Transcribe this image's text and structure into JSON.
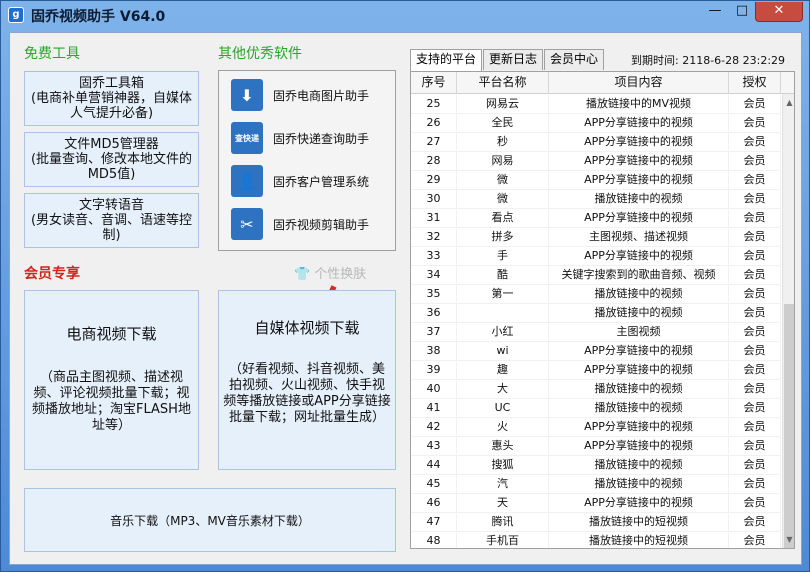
{
  "window": {
    "title": "固乔视频助手 V64.0",
    "app_icon": "g",
    "minimize": "—",
    "maximize": "□",
    "close": "✕"
  },
  "free_tools": {
    "heading": "免费工具",
    "buttons": [
      {
        "title": "固乔工具箱",
        "desc": "(电商补单营销神器，自媒体人气提升必备)"
      },
      {
        "title": "文件MD5管理器",
        "desc": "(批量查询、修改本地文件的MD5值)"
      },
      {
        "title": "文字转语音",
        "desc": "(男女读音、音调、语速等控制)"
      }
    ]
  },
  "other_software": {
    "heading": "其他优秀软件",
    "items": [
      {
        "label": "固乔电商图片助手",
        "icon": "download-icon",
        "glyph": "⬇"
      },
      {
        "label": "固乔快递查询助手",
        "icon": "express-query-icon",
        "glyph": "查快递"
      },
      {
        "label": "固乔客户管理系统",
        "icon": "customer-icon",
        "glyph": "👤"
      },
      {
        "label": "固乔视频剪辑助手",
        "icon": "scissors-icon",
        "glyph": "✂"
      }
    ]
  },
  "skin": {
    "label": "个性换肤",
    "icon": "tshirt-icon",
    "glyph": "👕"
  },
  "arrow_glyph": "⬇",
  "member": {
    "heading": "会员专享",
    "ecom_video": {
      "title": "电商视频下载",
      "desc": "（商品主图视频、描述视频、评论视频批量下载；视频播放地址；淘宝FLASH地址等）"
    },
    "media_video": {
      "title": "自媒体视频下载",
      "desc": "（好看视频、抖音视频、美拍视频、火山视频、快手视频等播放链接或APP分享链接批量下载；网址批量生成）"
    },
    "music": {
      "title": "音乐下载（MP3、MV音乐素材下载）"
    }
  },
  "tabs": [
    "支持的平台",
    "更新日志",
    "会员中心"
  ],
  "expiry": "到期时间: 2118-6-28 23:2:29",
  "table": {
    "headers": [
      "序号",
      "平台名称",
      "项目内容",
      "授权"
    ],
    "rows": [
      [
        "25",
        "网易云",
        "播放链接中的MV视频",
        "会员"
      ],
      [
        "26",
        "全民",
        "APP分享链接中的视频",
        "会员"
      ],
      [
        "27",
        "秒",
        "APP分享链接中的视频",
        "会员"
      ],
      [
        "28",
        "网易",
        "APP分享链接中的视频",
        "会员"
      ],
      [
        "29",
        "微",
        "APP分享链接中的视频",
        "会员"
      ],
      [
        "30",
        "微",
        "播放链接中的视频",
        "会员"
      ],
      [
        "31",
        "看点",
        "APP分享链接中的视频",
        "会员"
      ],
      [
        "32",
        "拼多",
        "主图视频、描述视频",
        "会员"
      ],
      [
        "33",
        "手",
        "APP分享链接中的视频",
        "会员"
      ],
      [
        "34",
        "酷",
        "关键字搜索到的歌曲音频、视频",
        "会员"
      ],
      [
        "35",
        "第一",
        "播放链接中的视频",
        "会员"
      ],
      [
        "36",
        "",
        "播放链接中的视频",
        "会员"
      ],
      [
        "37",
        "小红",
        "主图视频",
        "会员"
      ],
      [
        "38",
        "wi",
        "APP分享链接中的视频",
        "会员"
      ],
      [
        "39",
        "趣",
        "APP分享链接中的视频",
        "会员"
      ],
      [
        "40",
        "大",
        "播放链接中的视频",
        "会员"
      ],
      [
        "41",
        "UC",
        "播放链接中的视频",
        "会员"
      ],
      [
        "42",
        "火",
        "APP分享链接中的视频",
        "会员"
      ],
      [
        "43",
        "惠头",
        "APP分享链接中的视频",
        "会员"
      ],
      [
        "44",
        "搜狐",
        "播放链接中的视频",
        "会员"
      ],
      [
        "45",
        "汽",
        "播放链接中的视频",
        "会员"
      ],
      [
        "46",
        "天",
        "APP分享链接中的视频",
        "会员"
      ],
      [
        "47",
        "腾讯",
        "播放链接中的短视频",
        "会员"
      ],
      [
        "48",
        "手机百",
        "播放链接中的短视频",
        "会员"
      ]
    ]
  },
  "scroll": {
    "up": "▲",
    "down": "▼"
  }
}
